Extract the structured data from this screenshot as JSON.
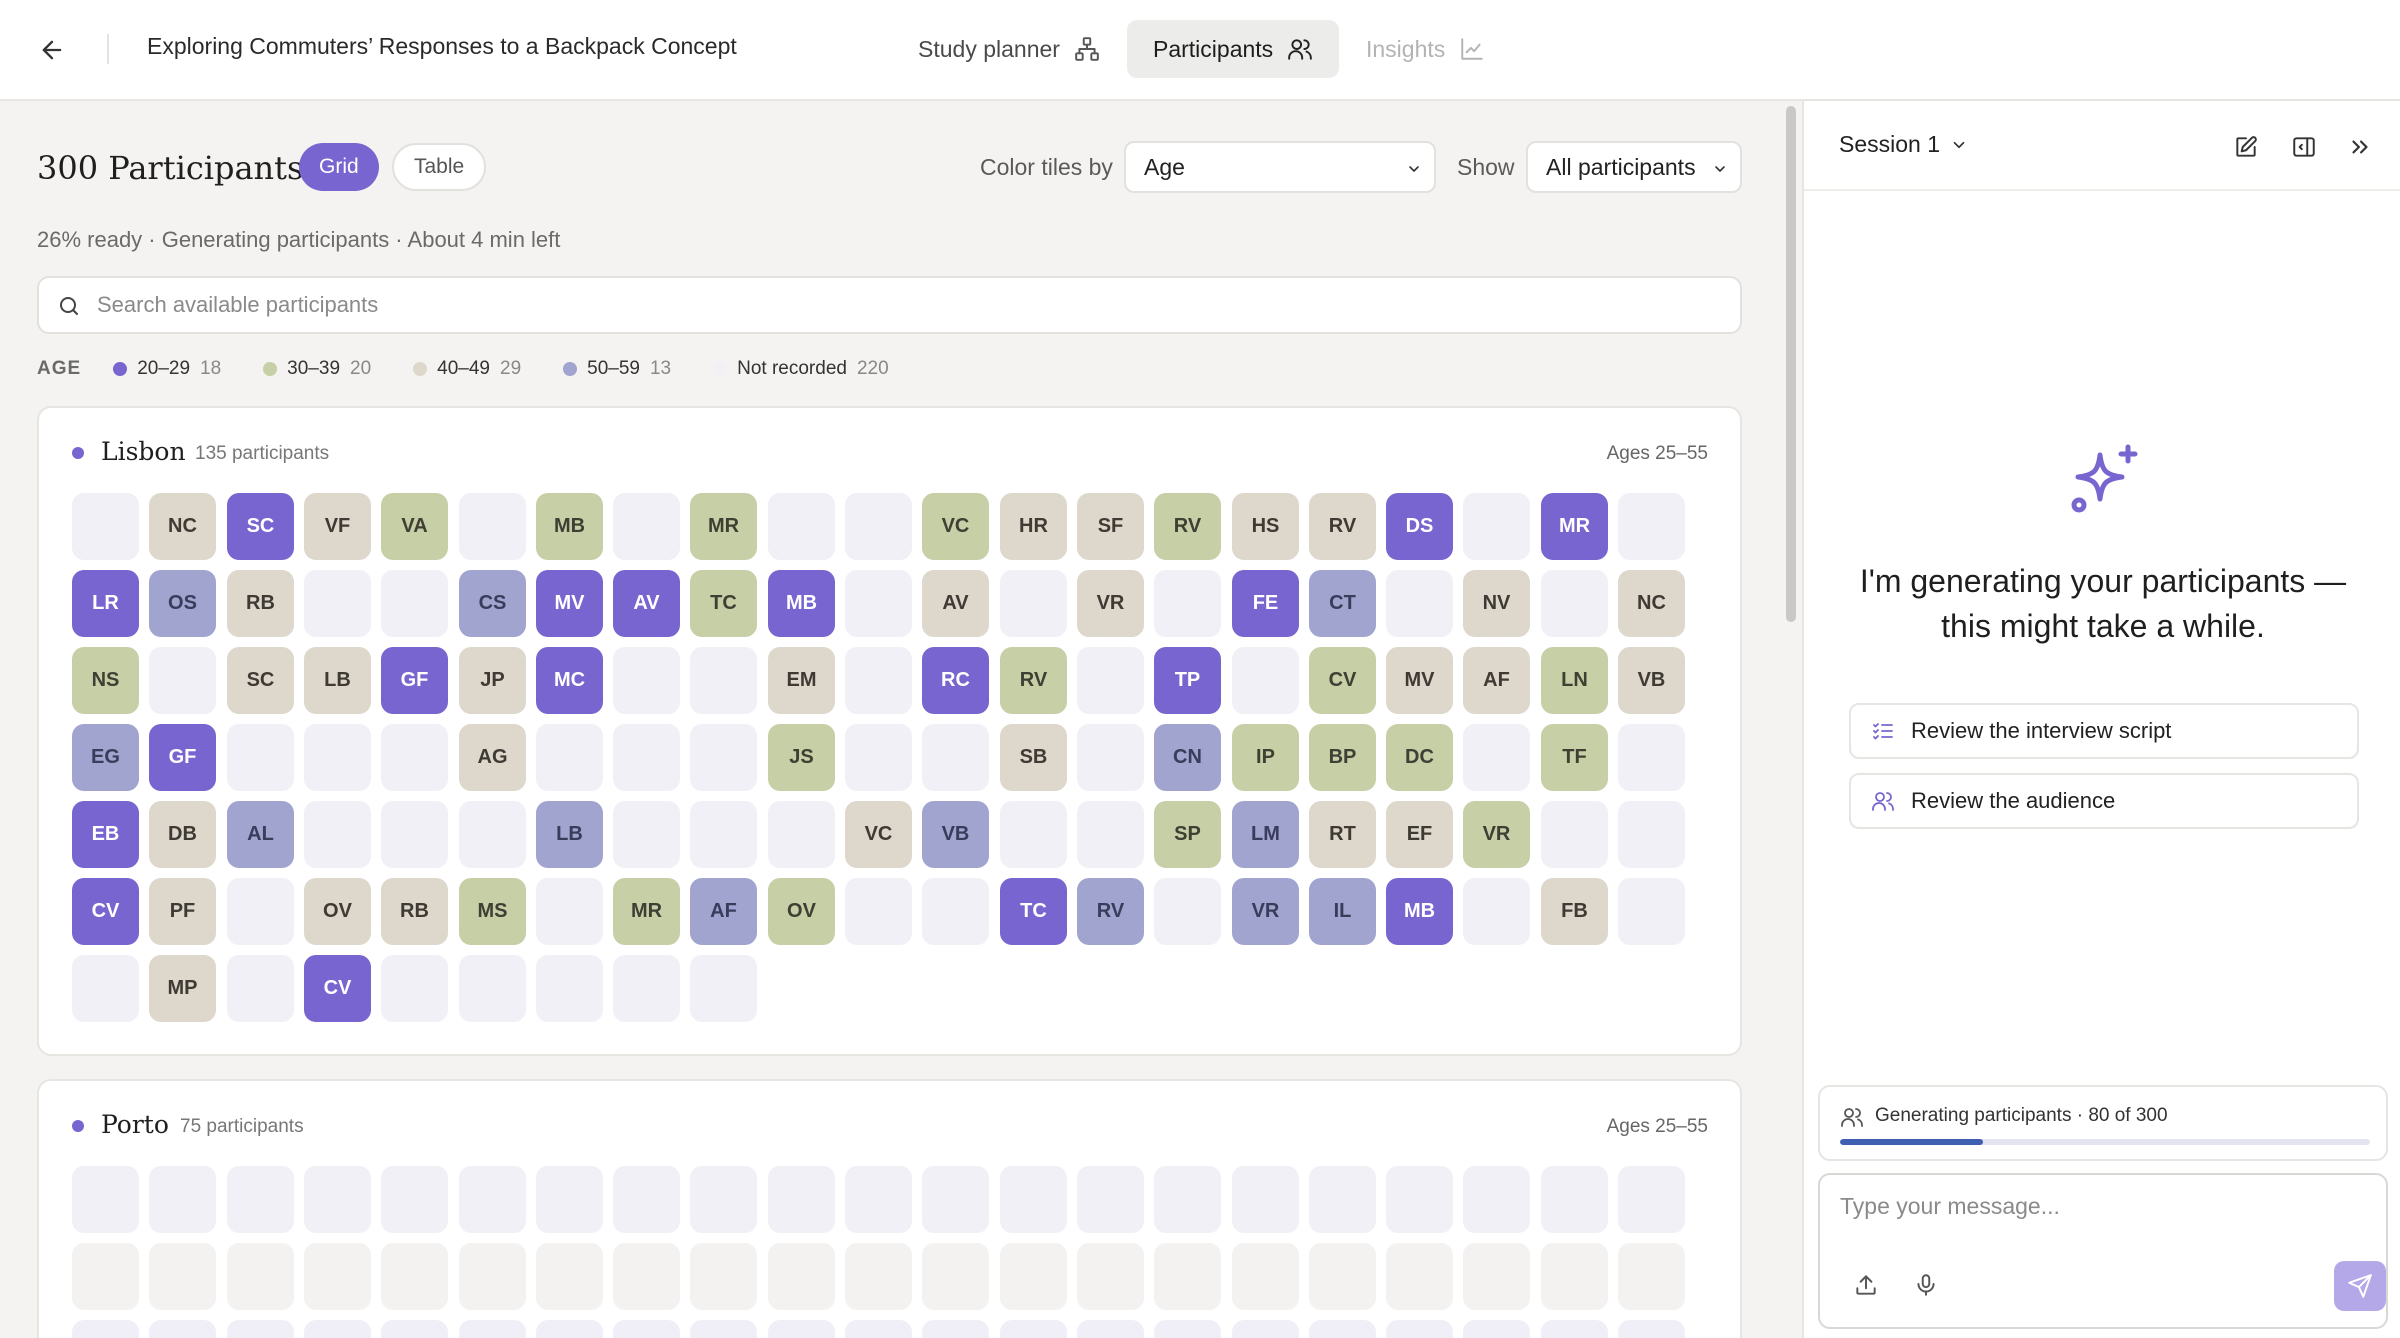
{
  "header": {
    "study_title": "Exploring Commuters’ Responses to a Backpack Concept",
    "tabs": [
      {
        "label": "Study planner",
        "state": "default"
      },
      {
        "label": "Participants",
        "state": "active"
      },
      {
        "label": "Insights",
        "state": "disabled"
      }
    ]
  },
  "main": {
    "count_title": "300 Participants",
    "view_toggle": {
      "grid_label": "Grid",
      "table_label": "Table",
      "selected": "Grid"
    },
    "color_by": {
      "label": "Color tiles by",
      "value": "Age"
    },
    "show": {
      "label": "Show",
      "value": "All participants"
    },
    "status": "26% ready · Generating participants · About 4 min left",
    "search": {
      "placeholder": "Search available participants",
      "value": ""
    },
    "legend": {
      "title": "AGE",
      "items": [
        {
          "label": "20–29",
          "count": "18",
          "color": "#7865cf"
        },
        {
          "label": "30–39",
          "count": "20",
          "color": "#c6cfa6"
        },
        {
          "label": "40–49",
          "count": "29",
          "color": "#ddd7cc"
        },
        {
          "label": "50–59",
          "count": "13",
          "color": "#a0a4cf"
        },
        {
          "label": "Not recorded",
          "count": "220",
          "color": "#f1f0f4"
        }
      ]
    },
    "groups": [
      {
        "name": "Lisbon",
        "count": "135 participants",
        "ages": "Ages 25–55",
        "rows": [
          [
            [
              "",
              "e"
            ],
            [
              "NC",
              "c"
            ],
            [
              "SC",
              "a"
            ],
            [
              "VF",
              "c"
            ],
            [
              "VA",
              "b"
            ],
            [
              "",
              "e"
            ],
            [
              "MB",
              "b"
            ],
            [
              "",
              "e"
            ],
            [
              "MR",
              "b"
            ],
            [
              "",
              "e"
            ],
            [
              "",
              "e"
            ],
            [
              "VC",
              "b"
            ],
            [
              "HR",
              "c"
            ],
            [
              "SF",
              "c"
            ],
            [
              "RV",
              "b"
            ],
            [
              "HS",
              "c"
            ],
            [
              "RV",
              "c"
            ],
            [
              "DS",
              "a"
            ],
            [
              "",
              "e"
            ],
            [
              "MR",
              "a"
            ],
            [
              "",
              "e"
            ]
          ],
          [
            [
              "LR",
              "a"
            ],
            [
              "OS",
              "d"
            ],
            [
              "RB",
              "c"
            ],
            [
              "",
              "e"
            ],
            [
              "",
              "e"
            ],
            [
              "CS",
              "d"
            ],
            [
              "MV",
              "a"
            ],
            [
              "AV",
              "a"
            ],
            [
              "TC",
              "b"
            ],
            [
              "MB",
              "a"
            ],
            [
              "",
              "e"
            ],
            [
              "AV",
              "c"
            ],
            [
              "",
              "e"
            ],
            [
              "VR",
              "c"
            ],
            [
              "",
              "e"
            ],
            [
              "FE",
              "a"
            ],
            [
              "CT",
              "d"
            ],
            [
              "",
              "e"
            ],
            [
              "NV",
              "c"
            ],
            [
              "",
              "e"
            ],
            [
              "NC",
              "c"
            ]
          ],
          [
            [
              "NS",
              "b"
            ],
            [
              "",
              "e"
            ],
            [
              "SC",
              "c"
            ],
            [
              "LB",
              "c"
            ],
            [
              "GF",
              "a"
            ],
            [
              "JP",
              "c"
            ],
            [
              "MC",
              "a"
            ],
            [
              "",
              "e"
            ],
            [
              "",
              "e"
            ],
            [
              "EM",
              "c"
            ],
            [
              "",
              "e"
            ],
            [
              "RC",
              "a"
            ],
            [
              "RV",
              "b"
            ],
            [
              "",
              "e"
            ],
            [
              "TP",
              "a"
            ],
            [
              "",
              "e"
            ],
            [
              "CV",
              "b"
            ],
            [
              "MV",
              "c"
            ],
            [
              "AF",
              "c"
            ],
            [
              "LN",
              "b"
            ],
            [
              "VB",
              "c"
            ]
          ],
          [
            [
              "EG",
              "d"
            ],
            [
              "GF",
              "a"
            ],
            [
              "",
              "e"
            ],
            [
              "",
              "e"
            ],
            [
              "",
              "e"
            ],
            [
              "AG",
              "c"
            ],
            [
              "",
              "e"
            ],
            [
              "",
              "e"
            ],
            [
              "",
              "e"
            ],
            [
              "JS",
              "b"
            ],
            [
              "",
              "e"
            ],
            [
              "",
              "e"
            ],
            [
              "SB",
              "c"
            ],
            [
              "",
              "e"
            ],
            [
              "CN",
              "d"
            ],
            [
              "IP",
              "b"
            ],
            [
              "BP",
              "b"
            ],
            [
              "DC",
              "b"
            ],
            [
              "",
              "e"
            ],
            [
              "TF",
              "b"
            ],
            [
              "",
              "e"
            ]
          ],
          [
            [
              "EB",
              "a"
            ],
            [
              "DB",
              "c"
            ],
            [
              "AL",
              "d"
            ],
            [
              "",
              "e"
            ],
            [
              "",
              "e"
            ],
            [
              "",
              "e"
            ],
            [
              "LB",
              "d"
            ],
            [
              "",
              "e"
            ],
            [
              "",
              "e"
            ],
            [
              "",
              "e"
            ],
            [
              "VC",
              "c"
            ],
            [
              "VB",
              "d"
            ],
            [
              "",
              "e"
            ],
            [
              "",
              "e"
            ],
            [
              "SP",
              "b"
            ],
            [
              "LM",
              "d"
            ],
            [
              "RT",
              "c"
            ],
            [
              "EF",
              "c"
            ],
            [
              "VR",
              "b"
            ],
            [
              "",
              "e"
            ],
            [
              "",
              "e"
            ]
          ],
          [
            [
              "CV",
              "a"
            ],
            [
              "PF",
              "c"
            ],
            [
              "",
              "e"
            ],
            [
              "OV",
              "c"
            ],
            [
              "RB",
              "c"
            ],
            [
              "MS",
              "b"
            ],
            [
              "",
              "e"
            ],
            [
              "MR",
              "b"
            ],
            [
              "AF",
              "d"
            ],
            [
              "OV",
              "b"
            ],
            [
              "",
              "e"
            ],
            [
              "",
              "e"
            ],
            [
              "TC",
              "a"
            ],
            [
              "RV",
              "d"
            ],
            [
              "",
              "e"
            ],
            [
              "VR",
              "d"
            ],
            [
              "IL",
              "d"
            ],
            [
              "MB",
              "a"
            ],
            [
              "",
              "e"
            ],
            [
              "FB",
              "c"
            ],
            [
              "",
              "e"
            ]
          ],
          [
            [
              "",
              "e"
            ],
            [
              "MP",
              "c"
            ],
            [
              "",
              "e"
            ],
            [
              "CV",
              "a"
            ],
            [
              "",
              "e"
            ],
            [
              "",
              "e"
            ],
            [
              "",
              "e"
            ],
            [
              "",
              "e"
            ],
            [
              "",
              "e"
            ]
          ]
        ]
      },
      {
        "name": "Porto",
        "count": "75 participants",
        "ages": "Ages 25–55",
        "rows": [
          [
            [
              "",
              "e"
            ],
            [
              "",
              "e"
            ],
            [
              "",
              "e"
            ],
            [
              "",
              "e"
            ],
            [
              "",
              "e"
            ],
            [
              "",
              "e"
            ],
            [
              "",
              "e"
            ],
            [
              "",
              "e"
            ],
            [
              "",
              "e"
            ],
            [
              "",
              "e"
            ],
            [
              "",
              "e"
            ],
            [
              "",
              "e"
            ],
            [
              "",
              "e"
            ],
            [
              "",
              "e"
            ],
            [
              "",
              "e"
            ],
            [
              "",
              "e"
            ],
            [
              "",
              "e"
            ],
            [
              "",
              "e"
            ],
            [
              "",
              "e"
            ],
            [
              "",
              "e"
            ],
            [
              "",
              "e"
            ]
          ],
          [
            [
              "",
              "e"
            ],
            [
              "",
              "e"
            ],
            [
              "",
              "e"
            ],
            [
              "",
              "e"
            ],
            [
              "",
              "e"
            ],
            [
              "",
              "e"
            ],
            [
              "",
              "e"
            ],
            [
              "",
              "e"
            ],
            [
              "",
              "e"
            ],
            [
              "",
              "e"
            ],
            [
              "",
              "e"
            ],
            [
              "",
              "e"
            ],
            [
              "",
              "e"
            ],
            [
              "",
              "e"
            ],
            [
              "",
              "e"
            ],
            [
              "",
              "e"
            ],
            [
              "",
              "e"
            ],
            [
              "",
              "e"
            ],
            [
              "",
              "e"
            ],
            [
              "",
              "e"
            ],
            [
              "",
              "e"
            ]
          ],
          [
            [
              "",
              "e"
            ],
            [
              "",
              "e"
            ],
            [
              "",
              "e"
            ],
            [
              "",
              "e"
            ],
            [
              "",
              "e"
            ],
            [
              "",
              "e"
            ],
            [
              "",
              "e"
            ],
            [
              "",
              "e"
            ],
            [
              "",
              "e"
            ],
            [
              "",
              "e"
            ],
            [
              "",
              "e"
            ],
            [
              "",
              "e"
            ],
            [
              "",
              "e"
            ],
            [
              "",
              "e"
            ],
            [
              "",
              "e"
            ],
            [
              "",
              "e"
            ],
            [
              "",
              "e"
            ],
            [
              "",
              "e"
            ],
            [
              "",
              "e"
            ],
            [
              "",
              "e"
            ],
            [
              "",
              "e"
            ]
          ]
        ]
      }
    ]
  },
  "side": {
    "session_label": "Session 1",
    "generating_message": "I'm generating your participants — this might take a while.",
    "actions": [
      {
        "label": "Review the interview script",
        "icon": "checklist-icon"
      },
      {
        "label": "Review the audience",
        "icon": "users-icon"
      }
    ],
    "progress": {
      "label": "Generating participants · 80 of 300",
      "fraction": 0.27
    },
    "composer": {
      "placeholder": "Type your message...",
      "value": ""
    }
  },
  "colors": {
    "accent": "#7865cf",
    "tile_a_bg": "#7865cf",
    "tile_a_fg": "#ffffff",
    "tile_b_bg": "#c6cfa6",
    "tile_b_fg": "#3f3f33",
    "tile_c_bg": "#ddd7cc",
    "tile_c_fg": "#3f3a33",
    "tile_d_bg": "#a0a4cf",
    "tile_d_fg": "#3a3c5c",
    "tile_e_bg": "#f1f0f7"
  }
}
